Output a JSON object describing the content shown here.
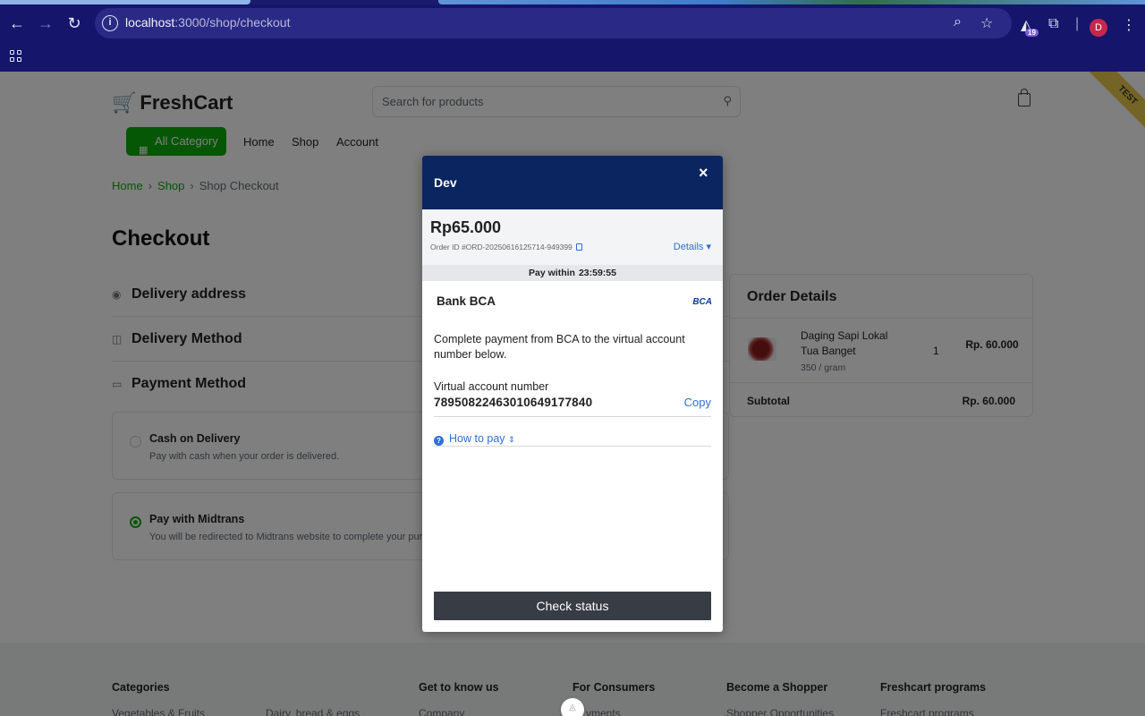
{
  "browser": {
    "url_host": "localhost",
    "url_path": ":3000/shop/checkout",
    "extension_badge": "19",
    "profile_initial": "D"
  },
  "header": {
    "logo_text": "FreshCart",
    "search_placeholder": "Search for products",
    "test_ribbon": "TEST",
    "all_category_label": "All Category",
    "nav": [
      "Home",
      "Shop",
      "Account"
    ]
  },
  "breadcrumb": [
    "Home",
    "Shop",
    "Shop Checkout"
  ],
  "checkout": {
    "title": "Checkout",
    "sections": [
      "Delivery address",
      "Delivery Method",
      "Payment Method"
    ],
    "payment_options": [
      {
        "title": "Cash on Delivery",
        "subtitle": "Pay with cash when your order is delivered.",
        "selected": false
      },
      {
        "title": "Pay with Midtrans",
        "subtitle": "You will be redirected to Midtrans website to complete your purcha",
        "selected": true
      }
    ]
  },
  "order_details": {
    "title": "Order Details",
    "item_name": "Daging Sapi Lokal Tua Banget",
    "item_unit": "350 / gram",
    "item_qty": "1",
    "item_price": "Rp. 60.000",
    "subtotal_label": "Subtotal",
    "subtotal_value": "Rp. 60.000"
  },
  "footer": {
    "columns": [
      {
        "heading": "Categories",
        "links": [
          "Vegetables & Fruits",
          "Dairy, bread & eggs"
        ]
      },
      {
        "heading": "Get to know us",
        "links": [
          "Company"
        ]
      },
      {
        "heading": "For Consumers",
        "links": [
          "yments"
        ]
      },
      {
        "heading": "Become a Shopper",
        "links": [
          "Shopper Opportunities"
        ]
      },
      {
        "heading": "Freshcart programs",
        "links": [
          "Freshcart programs"
        ]
      }
    ]
  },
  "modal": {
    "merchant": "Dev",
    "close": "×",
    "amount": "Rp65.000",
    "order_id": "Order ID #ORD-20250616125714-949399",
    "details_label": "Details ▾",
    "pay_within_label": "Pay within",
    "pay_within_time": "23:59:55",
    "bank_name": "Bank BCA",
    "bank_logo": "BCA",
    "instruction": "Complete payment from BCA to the virtual account number below.",
    "va_label": "Virtual account number",
    "va_number": "7895082246301064917784​0",
    "copy_label": "Copy",
    "how_to_pay": "How to pay",
    "check_status": "Check status"
  }
}
